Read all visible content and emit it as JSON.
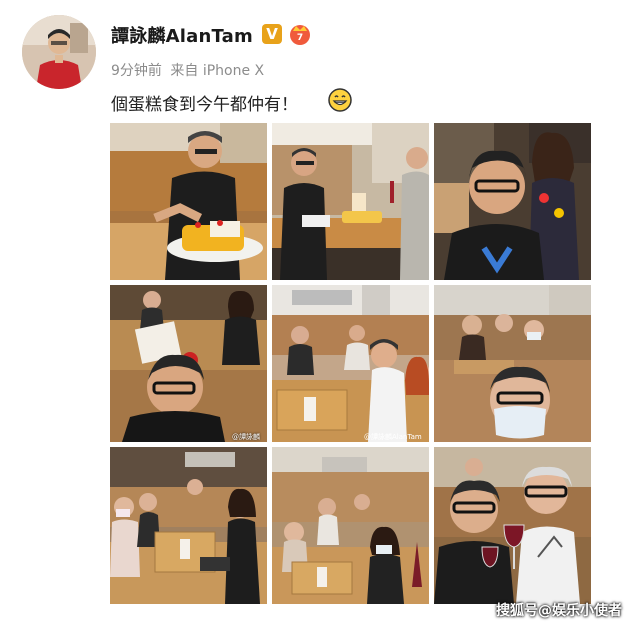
{
  "post": {
    "author": "譚詠麟AlanTam",
    "verified_badge": "V",
    "time": "9分钟前",
    "source": "来自 iPhone X",
    "text": "個蛋糕食到今午都仲有！",
    "emoji": "grinning-face-icon"
  },
  "photos": [
    {
      "name": "photo-cake-cutting"
    },
    {
      "name": "photo-table-with-cake"
    },
    {
      "name": "photo-selfie-with-woman"
    },
    {
      "name": "photo-selfie-restaurant"
    },
    {
      "name": "photo-group-at-table"
    },
    {
      "name": "photo-masked-selfie"
    },
    {
      "name": "photo-wide-table-1"
    },
    {
      "name": "photo-wide-table-2"
    },
    {
      "name": "photo-wine-toast"
    }
  ],
  "watermark": "搜狐号@娱乐小使者",
  "photo_watermarks": {
    "p5": "@譚詠麟AlanTam",
    "p4": "@譚詠麟"
  },
  "colors": {
    "author": "#1a1a1a",
    "meta": "#8c8c8c",
    "vbadge": "#e8a21a"
  }
}
